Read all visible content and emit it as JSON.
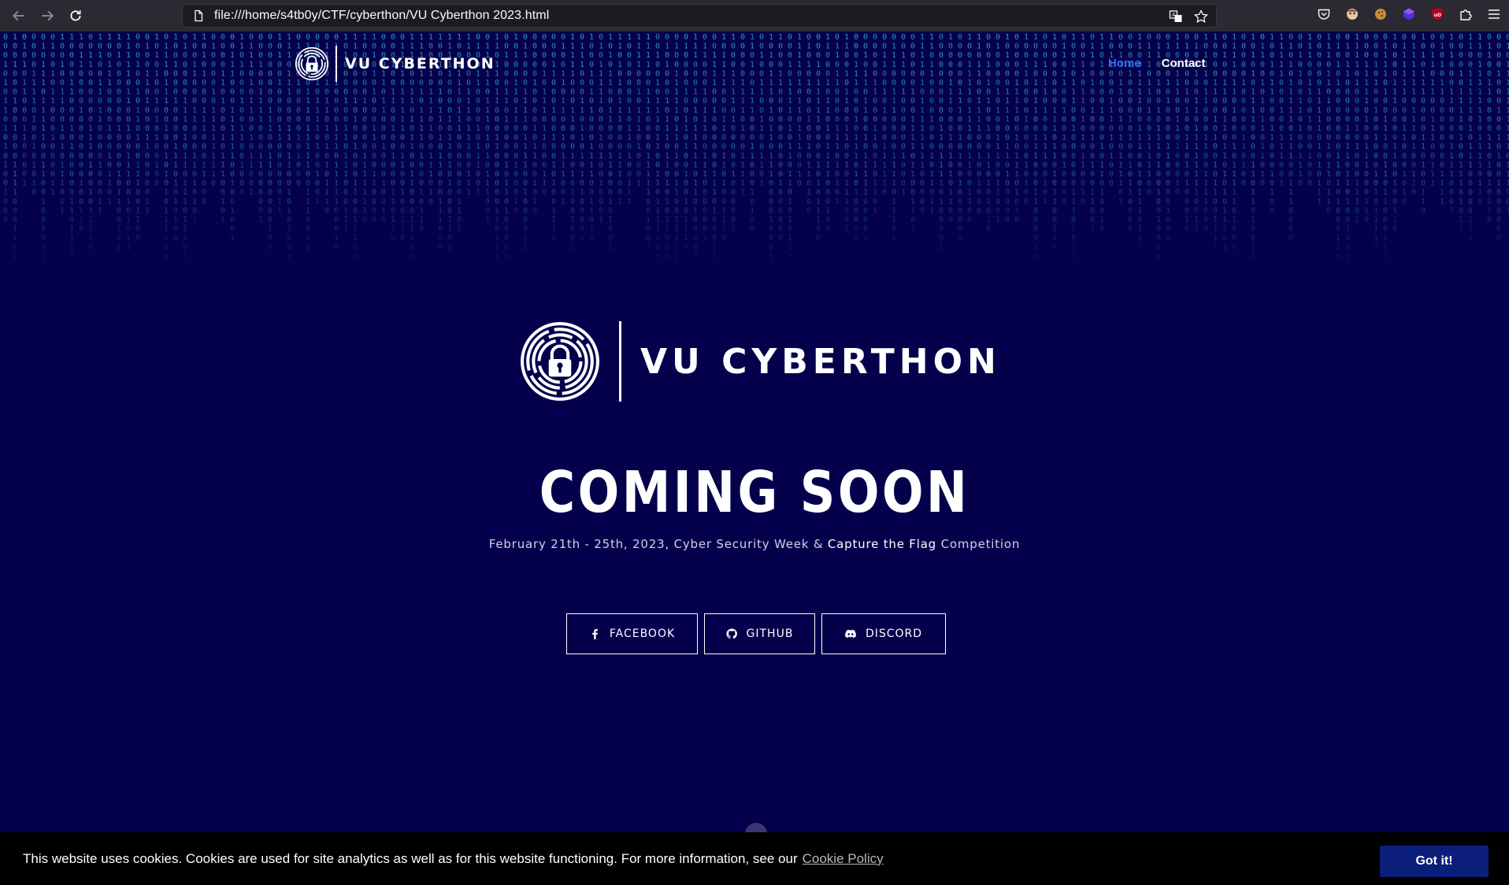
{
  "browser": {
    "url": "file:///home/s4tb0y/CTF/cyberthon/VU Cyberthon 2023.html"
  },
  "nav": {
    "logo_text": "VU CYBERTHON",
    "links": [
      {
        "label": "Home",
        "active": true
      },
      {
        "label": "Contact",
        "active": false
      }
    ]
  },
  "hero": {
    "logo_text": "VU CYBERTHON",
    "heading": "COMING SOON",
    "tagline_pre": "February 21th - 25th, 2023, Cyber Security Week & ",
    "tagline_strong": "Capture the Flag",
    "tagline_post": " Competition"
  },
  "social": [
    {
      "label": "FACEBOOK",
      "icon": "facebook-icon"
    },
    {
      "label": "GITHUB",
      "icon": "github-icon"
    },
    {
      "label": "DISCORD",
      "icon": "discord-icon"
    }
  ],
  "cookie": {
    "text": "This website uses cookies. Cookies are used for site analytics as well as for this website functioning. For more information, see our",
    "link": "Cookie Policy",
    "button": "Got it!"
  },
  "colors": {
    "page_bg": "#05004b",
    "nav_active": "#2f6ff0",
    "matrix_digits": "#3fb7d8",
    "cookie_button": "#0b1f7a"
  }
}
